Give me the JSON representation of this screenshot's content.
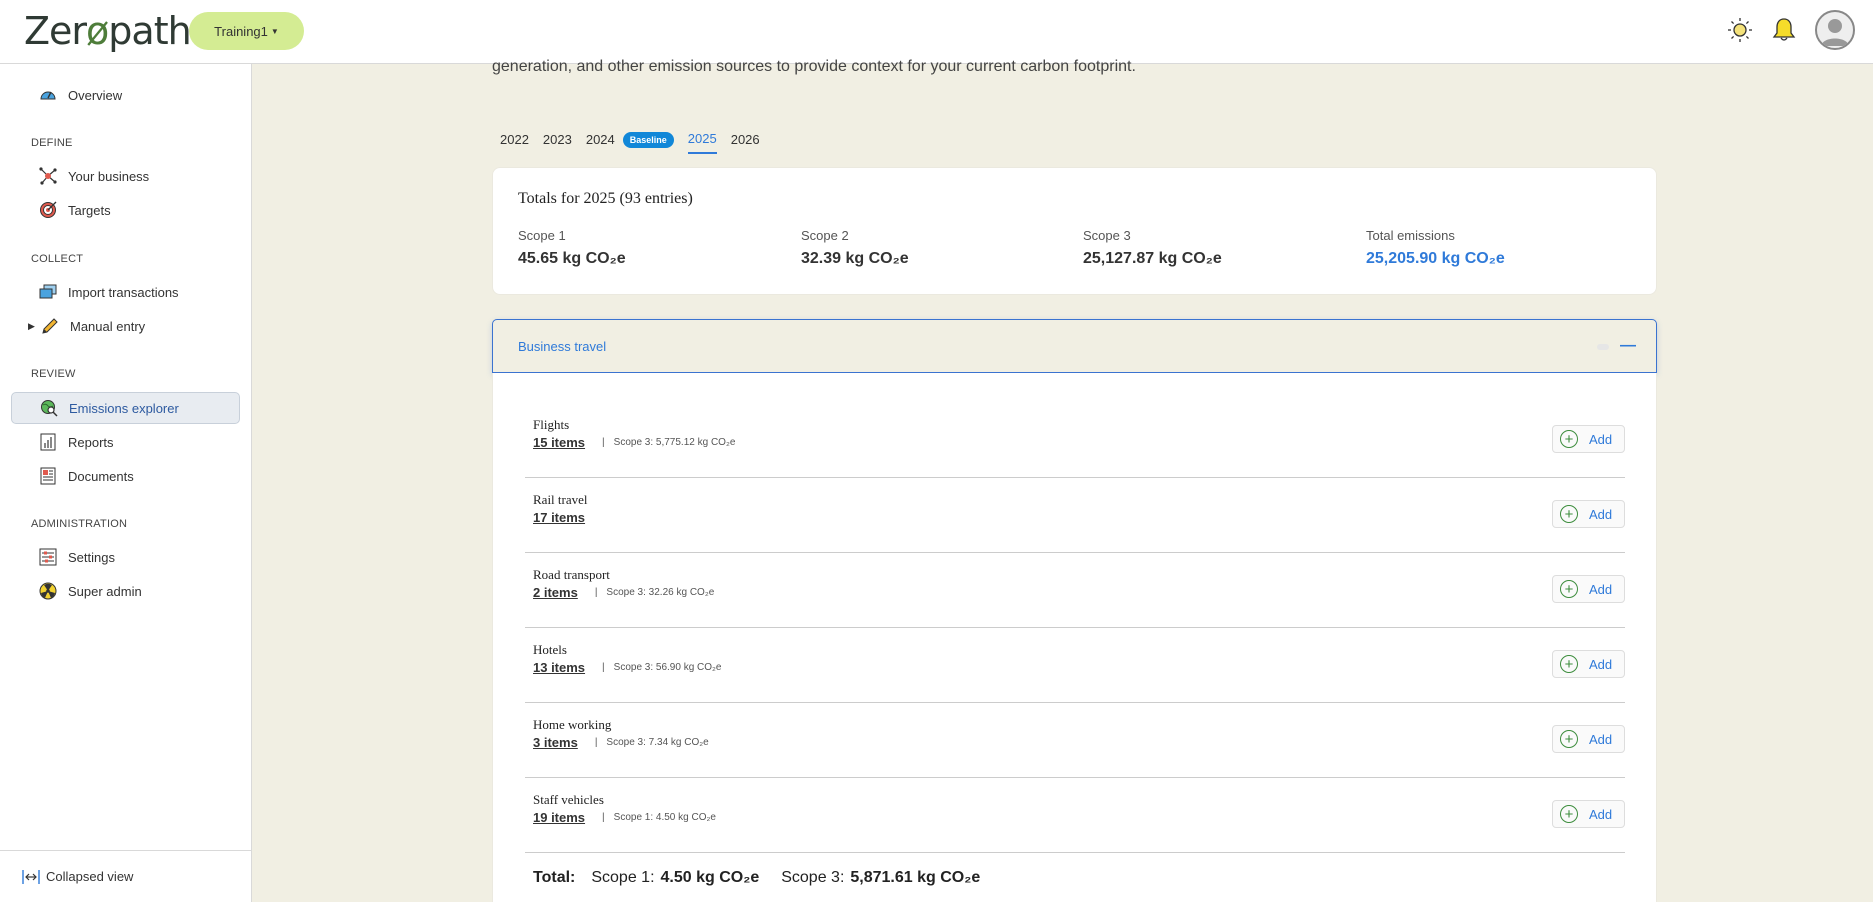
{
  "header": {
    "logo_text_a": "Zer",
    "logo_text_o": "ø",
    "logo_text_b": "path",
    "org_label": "Training1",
    "icons": [
      "sun-icon",
      "bell-icon",
      "avatar"
    ]
  },
  "sidebar": {
    "overview": "Overview",
    "define_label": "DEFINE",
    "your_business": "Your business",
    "targets": "Targets",
    "collect_label": "COLLECT",
    "import_transactions": "Import transactions",
    "manual_entry": "Manual entry",
    "review_label": "REVIEW",
    "emissions_explorer": "Emissions explorer",
    "reports": "Reports",
    "documents": "Documents",
    "administration_label": "ADMINISTRATION",
    "settings": "Settings",
    "super_admin": "Super admin",
    "collapsed_view": "Collapsed view"
  },
  "main": {
    "intro_text": "generation, and other emission sources to provide context for your current carbon footprint.",
    "years": [
      "2022",
      "2023",
      "2024",
      "2025",
      "2026"
    ],
    "baseline_label": "Baseline",
    "active_year": "2025",
    "totals": {
      "title": "Totals for 2025  (93 entries)",
      "scope1_label": "Scope 1",
      "scope1_value": "45.65 kg CO₂e",
      "scope2_label": "Scope 2",
      "scope2_value": "32.39 kg CO₂e",
      "scope3_label": "Scope 3",
      "scope3_value": "25,127.87 kg CO₂e",
      "total_label": "Total emissions",
      "total_value": "25,205.90 kg CO₂e"
    },
    "section_title": "Business travel",
    "add_label": "Add",
    "categories": [
      {
        "name": "Flights",
        "items": "15 items",
        "sep": "|",
        "scope": "Scope 3: 5,775.12 kg CO₂e"
      },
      {
        "name": "Rail travel",
        "items": "17 items",
        "sep": "",
        "scope": ""
      },
      {
        "name": "Road transport",
        "items": "2 items",
        "sep": "|",
        "scope": "Scope 3: 32.26 kg CO₂e"
      },
      {
        "name": "Hotels",
        "items": "13 items",
        "sep": "|",
        "scope": "Scope 3: 56.90 kg CO₂e"
      },
      {
        "name": "Home working",
        "items": "3 items",
        "sep": "|",
        "scope": "Scope 3: 7.34 kg CO₂e"
      },
      {
        "name": "Staff vehicles",
        "items": "19 items",
        "sep": "|",
        "scope": "Scope 1: 4.50 kg CO₂e"
      }
    ],
    "grand_total": {
      "label": "Total:",
      "scope1_prefix": "Scope 1:",
      "scope1_value": "4.50 kg CO₂e",
      "scope3_prefix": "Scope 3:",
      "scope3_value": "5,871.61 kg CO₂e"
    }
  }
}
